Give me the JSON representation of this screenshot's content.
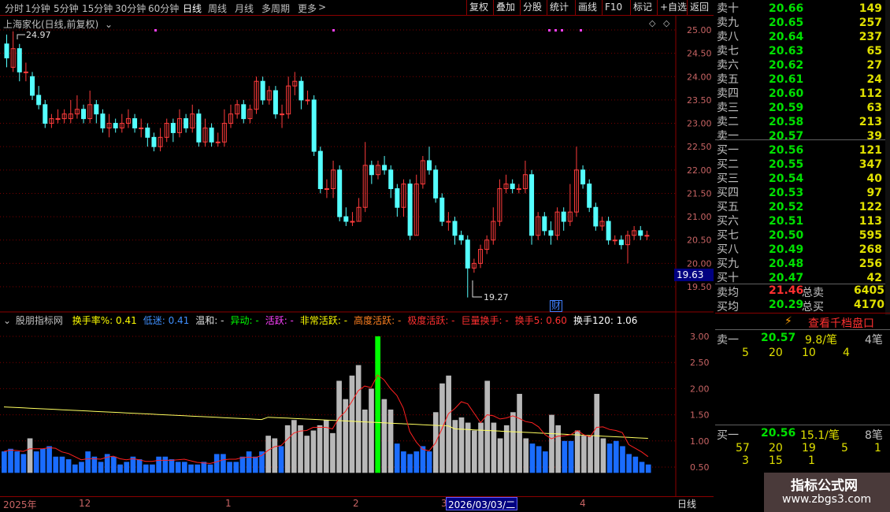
{
  "toolbar": {
    "periods": [
      "分时",
      "1分钟",
      "5分钟",
      "15分钟",
      "30分钟",
      "60分钟",
      "日线",
      "周线",
      "月线",
      "多周期",
      "更多"
    ],
    "active_period": "日线",
    "buttons": [
      "复权",
      "叠加",
      "分股",
      "统计",
      "画线",
      "F10",
      "标记",
      "+自选",
      "返回"
    ]
  },
  "stock": {
    "title": "上海家化(日线,前复权)",
    "high_marker": "24.97",
    "low_marker": "19.27",
    "cai_badge": "财"
  },
  "price_axis": {
    "ticks": [
      "25.00",
      "24.50",
      "24.00",
      "23.50",
      "23.00",
      "22.50",
      "22.00",
      "21.50",
      "21.00",
      "20.50",
      "20.00",
      "19.50"
    ],
    "current": "19.63"
  },
  "indicator": {
    "name": "股朋指标网",
    "items": [
      {
        "label": "换手率%: 0.41",
        "color": "#ffff00"
      },
      {
        "label": "低迷: 0.41",
        "color": "#4090ff"
      },
      {
        "label": "温和: -",
        "color": "#e0e0e0"
      },
      {
        "label": "异动: -",
        "color": "#00ff00"
      },
      {
        "label": "活跃: -",
        "color": "#ff40ff"
      },
      {
        "label": "非常活跃: -",
        "color": "#ffff00"
      },
      {
        "label": "高度活跃: -",
        "color": "#ff8020"
      },
      {
        "label": "极度活跃: -",
        "color": "#ff3030"
      },
      {
        "label": "巨量换手: -",
        "color": "#ff3030"
      },
      {
        "label": "换手5: 0.60",
        "color": "#ff3030"
      },
      {
        "label": "换手120: 1.06",
        "color": "#ffffff"
      }
    ],
    "axis_ticks": [
      "3.00",
      "2.50",
      "2.00",
      "1.50",
      "1.00",
      "0.50"
    ]
  },
  "date_axis": {
    "labels": [
      "2025年",
      "12",
      "1",
      "2",
      "3",
      "4"
    ],
    "selected": "2026/03/03/二",
    "period": "日线"
  },
  "order_book": {
    "asks": [
      {
        "label": "卖十",
        "price": "20.66",
        "vol": "149"
      },
      {
        "label": "卖九",
        "price": "20.65",
        "vol": "257"
      },
      {
        "label": "卖八",
        "price": "20.64",
        "vol": "237"
      },
      {
        "label": "卖七",
        "price": "20.63",
        "vol": "65"
      },
      {
        "label": "卖六",
        "price": "20.62",
        "vol": "27"
      },
      {
        "label": "卖五",
        "price": "20.61",
        "vol": "24"
      },
      {
        "label": "卖四",
        "price": "20.60",
        "vol": "112"
      },
      {
        "label": "卖三",
        "price": "20.59",
        "vol": "63"
      },
      {
        "label": "卖二",
        "price": "20.58",
        "vol": "213"
      },
      {
        "label": "卖一",
        "price": "20.57",
        "vol": "39"
      }
    ],
    "bids": [
      {
        "label": "买一",
        "price": "20.56",
        "vol": "121"
      },
      {
        "label": "买二",
        "price": "20.55",
        "vol": "347"
      },
      {
        "label": "买三",
        "price": "20.54",
        "vol": "40"
      },
      {
        "label": "买四",
        "price": "20.53",
        "vol": "97"
      },
      {
        "label": "买五",
        "price": "20.52",
        "vol": "122"
      },
      {
        "label": "买六",
        "price": "20.51",
        "vol": "113"
      },
      {
        "label": "买七",
        "price": "20.50",
        "vol": "595"
      },
      {
        "label": "买八",
        "price": "20.49",
        "vol": "268"
      },
      {
        "label": "买九",
        "price": "20.48",
        "vol": "256"
      },
      {
        "label": "买十",
        "price": "20.47",
        "vol": "42"
      }
    ],
    "avg_sell": {
      "label": "卖均",
      "price": "21.46",
      "total_label": "总卖",
      "total": "6405"
    },
    "avg_buy": {
      "label": "买均",
      "price": "20.29",
      "total_label": "总买",
      "total": "4170"
    },
    "query_button": "查看千档盘口",
    "queue_ask": {
      "label": "卖一",
      "price": "20.57",
      "per": "9.8/笔",
      "count": "4笔",
      "details": [
        "5",
        "20",
        "10",
        "4"
      ]
    },
    "queue_bid": {
      "label": "买一",
      "price": "20.56",
      "per": "15.1/笔",
      "count": "8笔",
      "details_row1": [
        "57",
        "20",
        "19",
        "5",
        "1"
      ],
      "details_row2": [
        "3",
        "15",
        "1"
      ]
    }
  },
  "watermark": {
    "line1": "指标公式网",
    "line2": "www.zbgs3.com"
  }
}
